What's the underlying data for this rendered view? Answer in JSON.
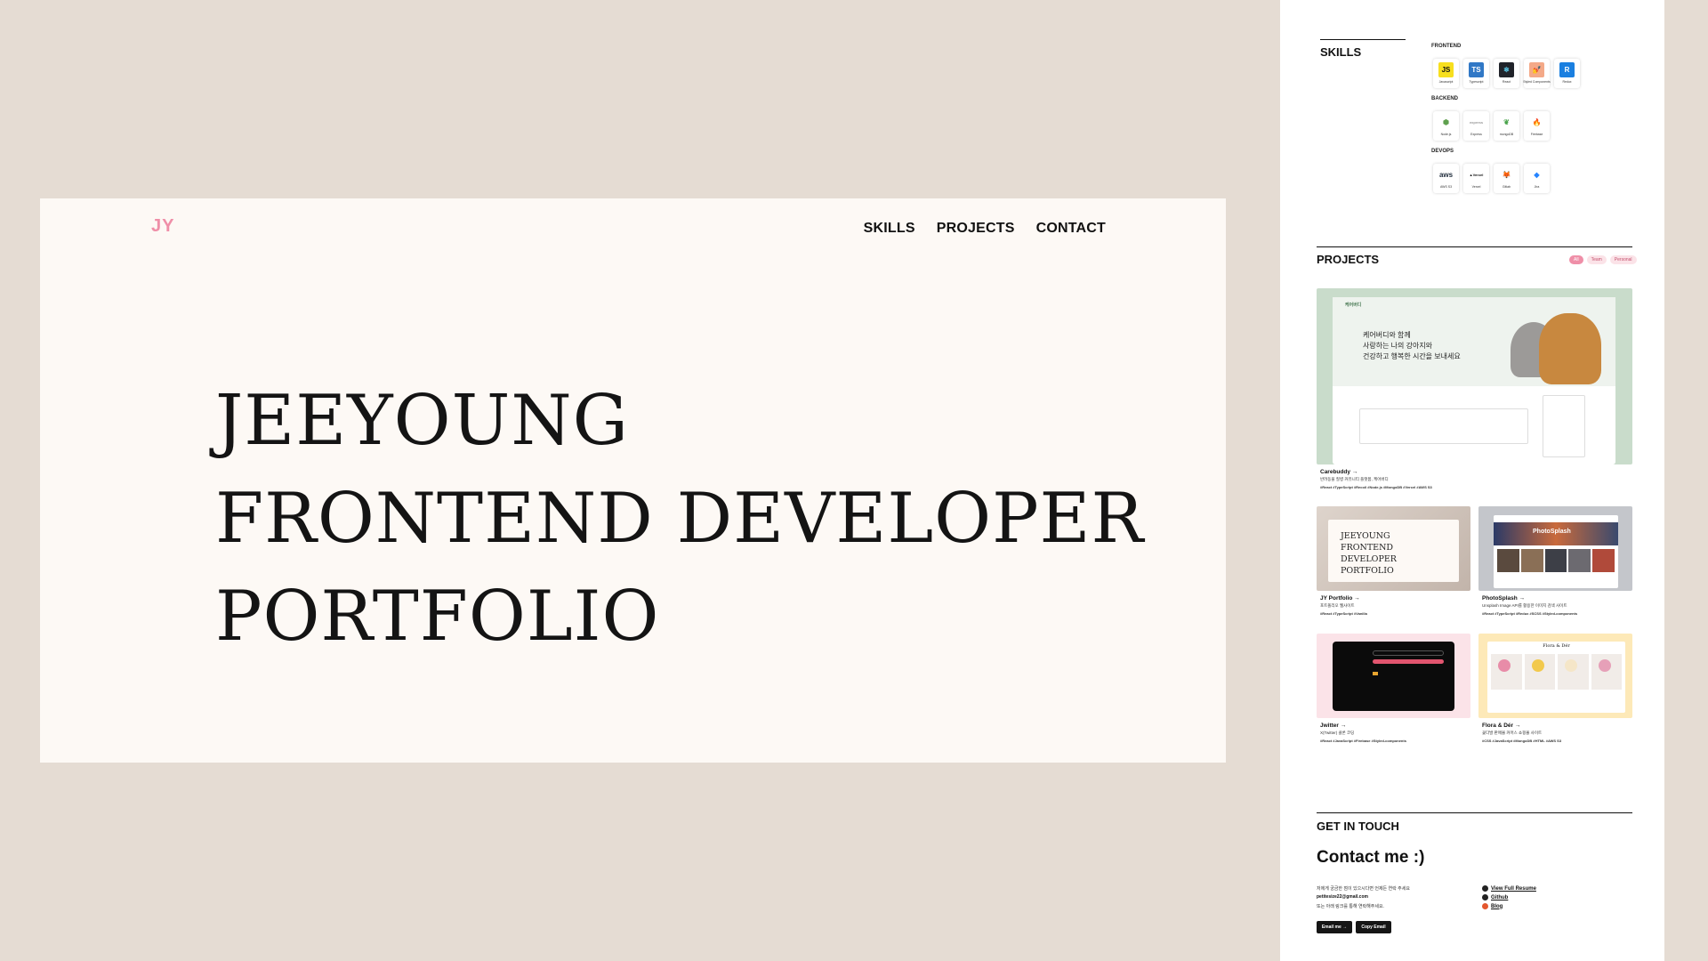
{
  "hero": {
    "logo": "JY",
    "nav": [
      "SKILLS",
      "PROJECTS",
      "CONTACT"
    ],
    "headline": [
      "JEEYOUNG",
      "FRONTEND DEVELOPER",
      "PORTFOLIO"
    ]
  },
  "skills": {
    "title": "SKILLS",
    "groups": [
      {
        "label": "FRONTEND",
        "items": [
          {
            "name": "Javascript",
            "icon": "JS",
            "color": "#f7df1e",
            "fg": "#111"
          },
          {
            "name": "Typescript",
            "icon": "TS",
            "color": "#3178c6",
            "fg": "#fff"
          },
          {
            "name": "React",
            "icon": "⚛",
            "color": "#20232a",
            "fg": "#61dafb"
          },
          {
            "name": "Styled Components",
            "icon": "💅",
            "color": "#f4a988",
            "fg": "#fff"
          },
          {
            "name": "Redux",
            "icon": "R",
            "color": "#1a7fe0",
            "fg": "#fff"
          }
        ]
      },
      {
        "label": "BACKEND",
        "items": [
          {
            "name": "Node.js",
            "icon": "⬢",
            "color": "#ffffff",
            "fg": "#5fa04e"
          },
          {
            "name": "Express",
            "icon": "express",
            "color": "#ffffff",
            "fg": "#999"
          },
          {
            "name": "mongoDB",
            "icon": "❦",
            "color": "#ffffff",
            "fg": "#47a248"
          },
          {
            "name": "Firebase",
            "icon": "🔥",
            "color": "#ffffff",
            "fg": "#f57c00"
          }
        ]
      },
      {
        "label": "DEVOPS",
        "items": [
          {
            "name": "AWS S3",
            "icon": "aws",
            "color": "#ffffff",
            "fg": "#232f3e"
          },
          {
            "name": "Vercel",
            "icon": "▲Vercel",
            "color": "#ffffff",
            "fg": "#111"
          },
          {
            "name": "Gitlab",
            "icon": "🦊",
            "color": "#ffffff",
            "fg": "#e24329"
          },
          {
            "name": "Jira",
            "icon": "◆",
            "color": "#ffffff",
            "fg": "#2684ff"
          }
        ]
      }
    ]
  },
  "projects": {
    "title": "PROJECTS",
    "filters": [
      "All",
      "Team",
      "Personal"
    ],
    "items": [
      {
        "title": "Carebuddy →",
        "desc": "반려동물 질병 커뮤니티 플랫폼, 케어버디",
        "tags": "#React #TypeScript #Recoil #Node.js #MongoDB #Vercel #AWS S3",
        "thumb": "#c9dccb"
      },
      {
        "title": "JY Portfolio →",
        "desc": "포트폴리오 웹사이트",
        "tags": "#React #TypeScript #Vanilla",
        "thumb": "#d8cec6"
      },
      {
        "title": "PhotoSplash →",
        "desc": "Unsplash Image API를 활용한 이미지 검색 사이트",
        "tags": "#React #TypeScript #Redux #SCSS #Styled-components",
        "thumb": "#c4c6cb"
      },
      {
        "title": "Jwitter →",
        "desc": "X(Twitter) 클론 코딩",
        "tags": "#React #JavaScript #Firebase #Styled-components",
        "thumb": "#fbe3e8"
      },
      {
        "title": "Flora & Dér →",
        "desc": "꽃다발 판매몰 커머스 쇼핑몰 사이트",
        "tags": "#CSS #JavaScript #MongoDB #HTML #AWS S3",
        "thumb": "#fde9b8"
      }
    ],
    "carebuddy_mock": {
      "brand": "케어버디",
      "hero": [
        "케어버디와 함께",
        "사랑하는 나의 강아지와",
        "건강하고 행복한 시간을 보내세요"
      ]
    },
    "portfolio_mock": [
      "JEEYOUNG",
      "FRONTEND DEVELOPER",
      "PORTFOLIO"
    ],
    "photosplash_mock": "PhotoSplash",
    "flora_mock": "Flora & Dér"
  },
  "contact": {
    "section": "GET IN TOUCH",
    "title": "Contact me :)",
    "line1": "저에게 궁금한 점이 있으시다면 언제든 연락 주세요",
    "email": "petitesize22@gmail.com",
    "line2": "또는 아래 링크를 통해 연락해주세요.",
    "links": [
      "View Full Resume",
      "Github",
      "Blog"
    ],
    "buttons": [
      "Email me →",
      "Copy Email"
    ]
  }
}
